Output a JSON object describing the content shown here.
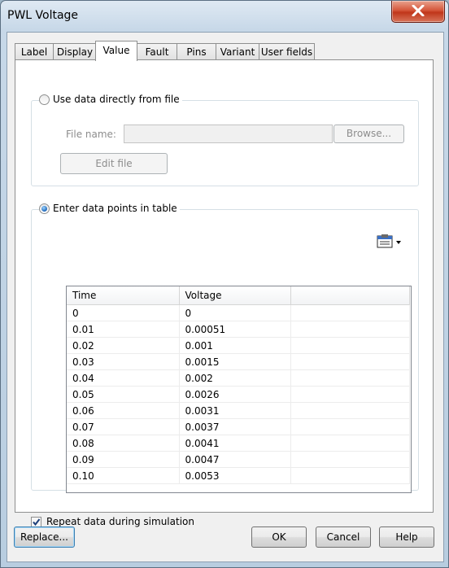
{
  "window": {
    "title": "PWL Voltage"
  },
  "tabs": [
    {
      "label": "Label",
      "active": false
    },
    {
      "label": "Display",
      "active": false
    },
    {
      "label": "Value",
      "active": true
    },
    {
      "label": "Fault",
      "active": false
    },
    {
      "label": "Pins",
      "active": false
    },
    {
      "label": "Variant",
      "active": false
    },
    {
      "label": "User fields",
      "active": false
    }
  ],
  "file_source": {
    "radio_label": "Use data directly from file",
    "selected": false,
    "file_name_label": "File name:",
    "file_name_value": "",
    "browse_label": "Browse...",
    "edit_label": "Edit file"
  },
  "table_source": {
    "radio_label": "Enter data points in table",
    "selected": true,
    "toolbar_icon": "table-options-icon",
    "columns": [
      "Time",
      "Voltage",
      ""
    ],
    "rows": [
      {
        "time": "0",
        "voltage": "0"
      },
      {
        "time": "0.01",
        "voltage": "0.00051"
      },
      {
        "time": "0.02",
        "voltage": "0.001"
      },
      {
        "time": "0.03",
        "voltage": "0.0015"
      },
      {
        "time": "0.04",
        "voltage": "0.002"
      },
      {
        "time": "0.05",
        "voltage": "0.0026"
      },
      {
        "time": "0.06",
        "voltage": "0.0031"
      },
      {
        "time": "0.07",
        "voltage": "0.0037"
      },
      {
        "time": "0.08",
        "voltage": "0.0041"
      },
      {
        "time": "0.09",
        "voltage": "0.0047"
      },
      {
        "time": "0.10",
        "voltage": "0.0053"
      }
    ]
  },
  "repeat": {
    "label": "Repeat data during simulation",
    "checked": true
  },
  "footer": {
    "replace_label": "Replace...",
    "ok_label": "OK",
    "cancel_label": "Cancel",
    "help_label": "Help"
  }
}
